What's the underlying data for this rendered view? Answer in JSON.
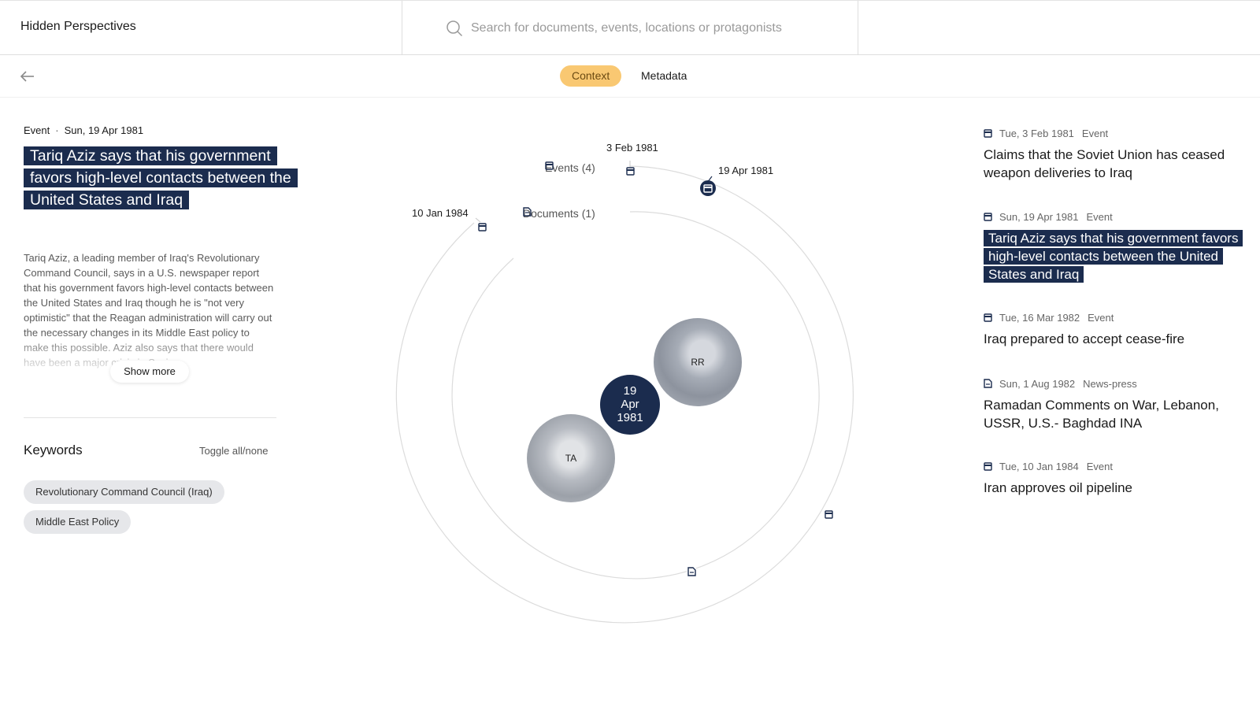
{
  "app": {
    "title": "Hidden Perspectives"
  },
  "search": {
    "placeholder": "Search for documents, events, locations or protagonists"
  },
  "tabs": {
    "context": "Context",
    "metadata": "Metadata"
  },
  "event": {
    "type": "Event",
    "separator": "·",
    "date": "Sun, 19 Apr 1981",
    "title": "Tariq Aziz says that his government favors high-level contacts between the United States and Iraq",
    "description": "Tariq Aziz, a leading member of Iraq's Revolutionary Command Council, says in a U.S. newspaper report that his government favors high-level contacts between the United States and Iraq though he is \"not very optimistic\" that the Reagan administration will carry out the necessary changes in its Middle East policy to make this possible. Aziz also says that there would have been a major crisis in Sovi...",
    "show_more": "Show more"
  },
  "keywords": {
    "title": "Keywords",
    "toggle": "Toggle all/none",
    "items": [
      "Revolutionary Command Council (Iraq)",
      "Middle East Policy"
    ]
  },
  "graph": {
    "events_group": "Events (4)",
    "documents_group": "Documents (1)",
    "center": {
      "line1": "19",
      "line2": "Apr",
      "line3": "1981"
    },
    "labels": {
      "feb_1981": "3 Feb 1981",
      "apr_1981": "19 Apr 1981",
      "jan_1984": "10 Jan 1984"
    },
    "protagonists": [
      {
        "initials": "RR",
        "icon": "portrait-photo"
      },
      {
        "initials": "TA",
        "icon": "portrait-photo"
      }
    ]
  },
  "list": [
    {
      "icon": "calendar-icon",
      "date": "Tue, 3 Feb 1981",
      "type": "Event",
      "title": "Claims that the Soviet Union has ceased weapon deliveries to Iraq",
      "active": false
    },
    {
      "icon": "calendar-icon",
      "date": "Sun, 19 Apr 1981",
      "type": "Event",
      "title": "Tariq Aziz says that his government favors high-level contacts between the United States and Iraq",
      "active": true
    },
    {
      "icon": "calendar-icon",
      "date": "Tue, 16 Mar 1982",
      "type": "Event",
      "title": "Iraq prepared to accept cease-fire",
      "active": false
    },
    {
      "icon": "document-icon",
      "date": "Sun, 1 Aug 1982",
      "type": "News-press",
      "title": "Ramadan Comments on War, Lebanon, USSR, U.S.- Baghdad INA",
      "active": false
    },
    {
      "icon": "calendar-icon",
      "date": "Tue, 10 Jan 1984",
      "type": "Event",
      "title": "Iran approves oil pipeline",
      "active": false
    }
  ],
  "colors": {
    "accent": "#f9c872",
    "navy": "#1b2c4e",
    "chip": "#e6e7ea",
    "ring": "#dcdcdc"
  }
}
